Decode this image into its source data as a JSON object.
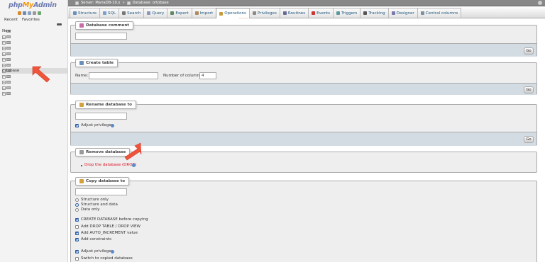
{
  "logo": {
    "php": "php",
    "my": "My",
    "admin": "Admin"
  },
  "nav": {
    "tabs": [
      "Recent",
      "Favorites"
    ],
    "tree": [
      {
        "label": "New",
        "kind": "new"
      },
      {
        "label": "",
        "kind": "db"
      },
      {
        "label": "",
        "kind": "db"
      },
      {
        "label": "",
        "kind": "db"
      },
      {
        "label": "",
        "kind": "db"
      },
      {
        "label": "",
        "kind": "db"
      },
      {
        "label": "",
        "kind": "db"
      },
      {
        "label": "ortobase",
        "kind": "db",
        "active": true
      },
      {
        "label": "",
        "kind": "db"
      },
      {
        "label": "",
        "kind": "db"
      },
      {
        "label": "",
        "kind": "db"
      },
      {
        "label": "",
        "kind": "db"
      }
    ]
  },
  "breadcrumb": {
    "server": "Server: MariaDB-10.x",
    "database": "Database: ortobase"
  },
  "tabs": [
    {
      "label": "Structure",
      "icon": "structure-icon",
      "color": "#6b8fbd"
    },
    {
      "label": "SQL",
      "icon": "sql-icon",
      "color": "#7aa0d0"
    },
    {
      "label": "Search",
      "icon": "search-icon",
      "color": "#777777"
    },
    {
      "label": "Query",
      "icon": "query-icon",
      "color": "#8899bb"
    },
    {
      "label": "Export",
      "icon": "export-icon",
      "color": "#5f8a5f"
    },
    {
      "label": "Import",
      "icon": "import-icon",
      "color": "#b08a5a"
    },
    {
      "label": "Operations",
      "icon": "operations-icon",
      "color": "#c79a3a",
      "active": true
    },
    {
      "label": "Privileges",
      "icon": "privileges-icon",
      "color": "#8a8a8a"
    },
    {
      "label": "Routines",
      "icon": "routines-icon",
      "color": "#6a6a9a"
    },
    {
      "label": "Events",
      "icon": "events-icon",
      "color": "#cc3333"
    },
    {
      "label": "Triggers",
      "icon": "triggers-icon",
      "color": "#5a9a9a"
    },
    {
      "label": "Tracking",
      "icon": "tracking-icon",
      "color": "#555555"
    },
    {
      "label": "Designer",
      "icon": "designer-icon",
      "color": "#7a7aaa"
    },
    {
      "label": "Central columns",
      "icon": "central-columns-icon",
      "color": "#7f8fa0"
    }
  ],
  "sections": {
    "db_comment": {
      "title": "Database comment",
      "value": "",
      "go": "Go"
    },
    "create_table": {
      "title": "Create table",
      "name_label": "Name:",
      "name_value": "",
      "columns_label": "Number of columns:",
      "columns_value": "4",
      "go": "Go"
    },
    "rename_db": {
      "title": "Rename database to",
      "value": "",
      "adjust_label": "Adjust privileges",
      "go": "Go"
    },
    "remove_db": {
      "title": "Remove database",
      "drop_label": "Drop the database (DROP)"
    },
    "copy_db": {
      "title": "Copy database to",
      "value": "",
      "radios": [
        "Structure only",
        "Structure and data",
        "Data only"
      ],
      "checks": [
        "CREATE DATABASE before copying",
        "Add DROP TABLE / DROP VIEW",
        "Add AUTO_INCREMENT value",
        "Add constraints"
      ],
      "adjust_label": "Adjust privileges",
      "switch_label": "Switch to copied database"
    }
  },
  "colors": {
    "accent": "#235a81",
    "annotation": "#f0553c",
    "drop_link": "#dd1122"
  }
}
